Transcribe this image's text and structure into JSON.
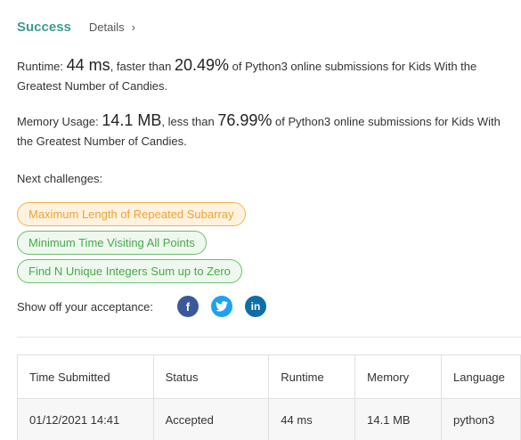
{
  "header": {
    "status": "Success",
    "details_label": "Details",
    "details_chevron": "›"
  },
  "runtime": {
    "label": "Runtime:",
    "value": "44 ms",
    "mid": ", faster than",
    "percent": "20.49%",
    "tail": "of Python3 online submissions for Kids With the Greatest Number of Candies."
  },
  "memory": {
    "label": "Memory Usage:",
    "value": "14.1 MB",
    "mid": ", less than",
    "percent": "76.99%",
    "tail": "of Python3 online submissions for Kids With the Greatest Number of Candies."
  },
  "next": {
    "label": "Next challenges:",
    "items": [
      {
        "title": "Maximum Length of Repeated Subarray",
        "difficulty": "medium"
      },
      {
        "title": "Minimum Time Visiting All Points",
        "difficulty": "easy"
      },
      {
        "title": "Find N Unique Integers Sum up to Zero",
        "difficulty": "easy"
      }
    ]
  },
  "share": {
    "label": "Show off your acceptance:",
    "icons": [
      {
        "name": "facebook-icon",
        "glyph": "f",
        "color": "#3b5998"
      },
      {
        "name": "twitter-icon",
        "glyph": "t",
        "color": "#1da1f2"
      },
      {
        "name": "linkedin-icon",
        "glyph": "in",
        "color": "#0e6fa6"
      }
    ]
  },
  "table": {
    "headers": [
      "Time Submitted",
      "Status",
      "Runtime",
      "Memory",
      "Language"
    ],
    "rows": [
      {
        "time": "01/12/2021 14:41",
        "status": "Accepted",
        "runtime": "44 ms",
        "memory": "14.1 MB",
        "language": "python3"
      }
    ]
  },
  "colors": {
    "accent": "#3e9b8f",
    "medium": "#f0a030",
    "easy": "#4aa84a"
  }
}
